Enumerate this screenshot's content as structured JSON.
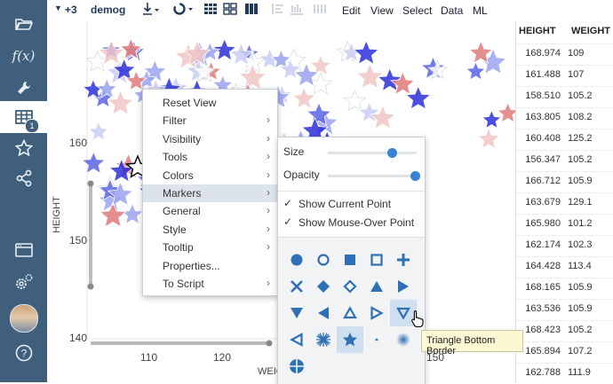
{
  "toolbar": {
    "extra_count": "+3",
    "dataset": "demog",
    "menus": [
      "Edit",
      "View",
      "Select",
      "Data",
      "ML"
    ]
  },
  "sidebar": {
    "items": [
      {
        "icon": "folder-open-icon"
      },
      {
        "icon": "function-icon",
        "label": "f(x)"
      },
      {
        "icon": "wrench-icon"
      },
      {
        "icon": "table-icon",
        "badge": "1",
        "active": true
      },
      {
        "icon": "star-icon"
      },
      {
        "icon": "share-icon"
      },
      {
        "icon": "window-icon"
      },
      {
        "icon": "settings-icon"
      },
      {
        "icon": "user-avatar"
      },
      {
        "icon": "help-icon",
        "label": "?"
      }
    ]
  },
  "chart_data": {
    "type": "scatter",
    "xlabel": "WEIGHT",
    "ylabel": "HEIGHT",
    "x_ticks": [
      "110",
      "120",
      "150"
    ],
    "y_ticks": [
      "140",
      "150",
      "160"
    ],
    "marker": "star",
    "colors": [
      "#2b2fd9",
      "#5a63e6",
      "#9aa3f0",
      "#c9cdf5",
      "#f0c6c6",
      "#e07a7a",
      "#ffffff"
    ]
  },
  "context_menu": {
    "items": [
      {
        "label": "Reset View",
        "submenu": false
      },
      {
        "label": "Filter",
        "submenu": true
      },
      {
        "label": "Visibility",
        "submenu": true
      },
      {
        "label": "Tools",
        "submenu": true
      },
      {
        "label": "Colors",
        "submenu": true
      },
      {
        "label": "Markers",
        "submenu": true,
        "highlighted": true
      },
      {
        "label": "General",
        "submenu": true
      },
      {
        "label": "Style",
        "submenu": true
      },
      {
        "label": "Tooltip",
        "submenu": true
      },
      {
        "label": "Properties...",
        "submenu": false
      },
      {
        "label": "To Script",
        "submenu": true
      }
    ]
  },
  "markers_submenu": {
    "size_label": "Size",
    "size_value": 0.72,
    "opacity_label": "Opacity",
    "opacity_value": 0.98,
    "show_current_point": "Show Current Point",
    "show_mouse_over_point": "Show Mouse-Over Point",
    "selected_marker": "star",
    "hovered_marker": "triangle-bottom-border"
  },
  "tooltip": "Triangle Bottom Border",
  "table": {
    "columns": [
      "HEIGHT",
      "WEIGHT"
    ],
    "rows": [
      [
        "168.974",
        "109"
      ],
      [
        "161.488",
        "107"
      ],
      [
        "158.510",
        "105.2"
      ],
      [
        "163.805",
        "108.2"
      ],
      [
        "160.408",
        "125.2"
      ],
      [
        "156.347",
        "105.2"
      ],
      [
        "166.712",
        "105.9"
      ],
      [
        "163.679",
        "129.1"
      ],
      [
        "165.980",
        "101.2"
      ],
      [
        "162.174",
        "102.3"
      ],
      [
        "164.428",
        "113.4"
      ],
      [
        "168.165",
        "105.9"
      ],
      [
        "163.536",
        "105.9"
      ],
      [
        "168.423",
        "105.2"
      ],
      [
        "165.894",
        "107.2"
      ],
      [
        "162.788",
        "111.9"
      ]
    ]
  }
}
